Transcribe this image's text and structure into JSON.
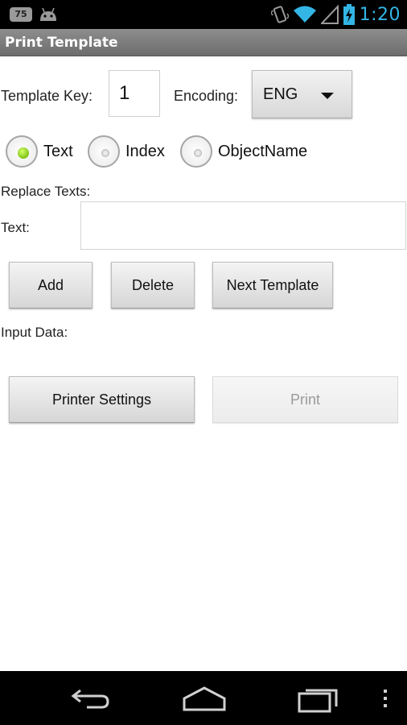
{
  "status_bar": {
    "badge": "75",
    "time": "1:20",
    "icons": [
      "notification-count-icon",
      "android-icon",
      "vibrate-icon",
      "wifi-icon",
      "signal-icon",
      "battery-charging-icon"
    ]
  },
  "app": {
    "title": "Print Template"
  },
  "form": {
    "template_key_label": "Template Key:",
    "template_key_value": "1",
    "encoding_label": "Encoding:",
    "encoding_selected": "ENG",
    "radios": [
      {
        "label": "Text",
        "checked": true
      },
      {
        "label": "Index",
        "checked": false
      },
      {
        "label": "ObjectName",
        "checked": false
      }
    ],
    "replace_texts_label": "Replace Texts:",
    "text_label": "Text:",
    "text_value": "",
    "input_data_label": "Input Data:"
  },
  "buttons": {
    "add": "Add",
    "delete": "Delete",
    "next_template": "Next Template",
    "printer_settings": "Printer Settings",
    "print": "Print"
  },
  "nav": {
    "icons": [
      "back-icon",
      "home-icon",
      "recent-apps-icon",
      "menu-overflow-icon"
    ]
  },
  "colors": {
    "accent": "#33b5e5",
    "radio_on": "#7fc415"
  }
}
